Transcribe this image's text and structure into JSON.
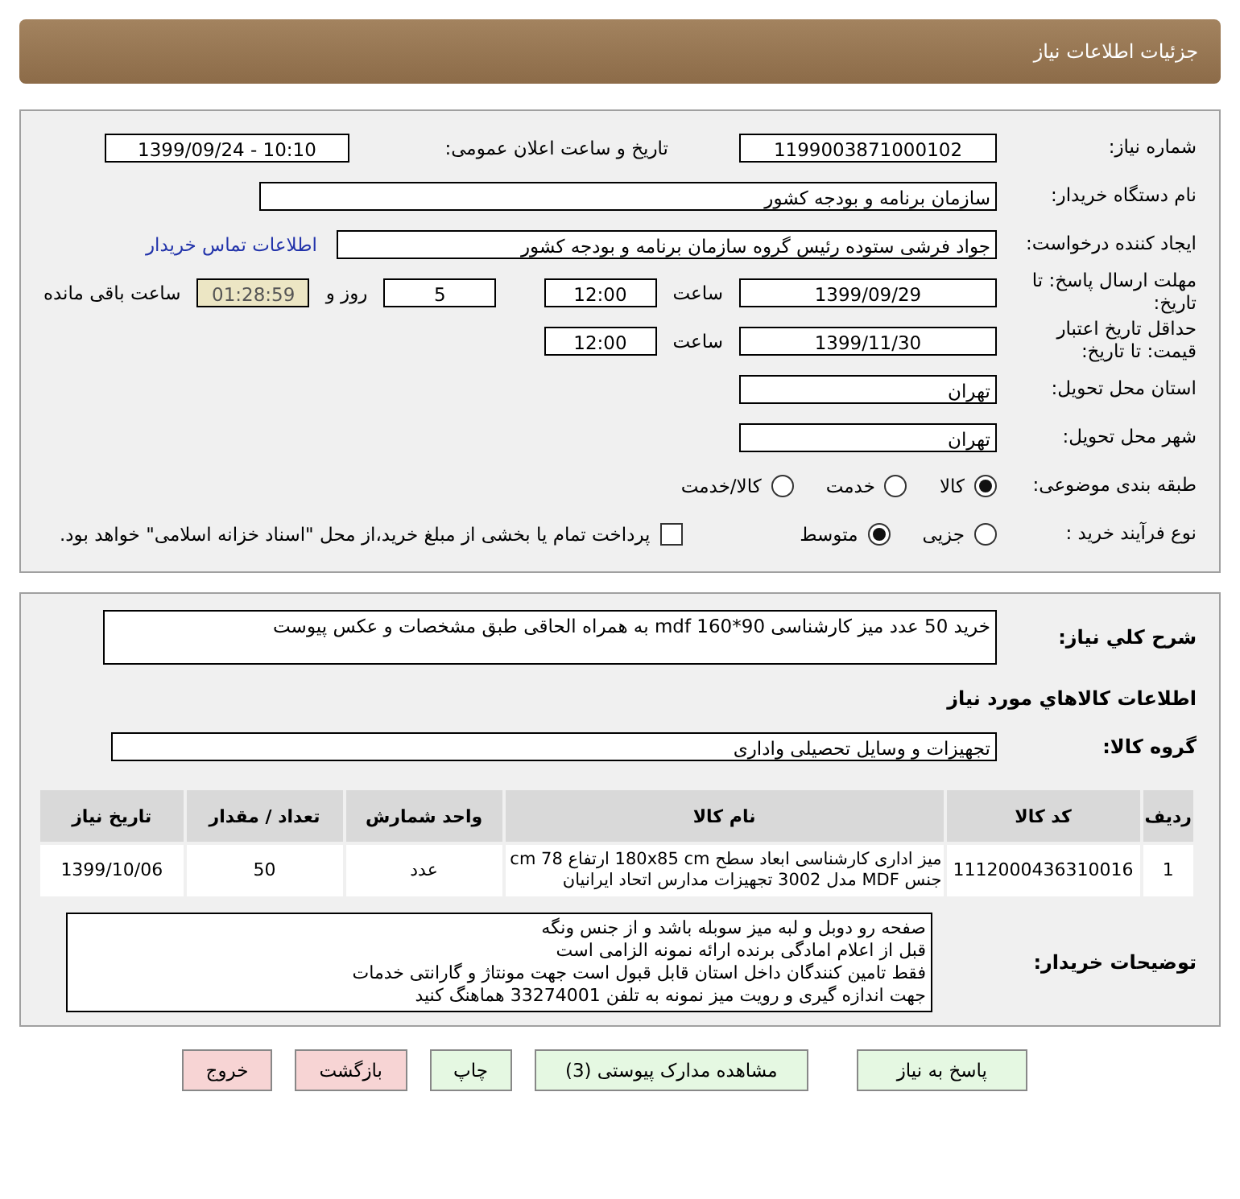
{
  "header": {
    "title": "جزئیات اطلاعات نیاز"
  },
  "need_number": {
    "label": "شماره نیاز:",
    "value": "1199003871000102"
  },
  "announce": {
    "label": "تاریخ و ساعت اعلان عمومی:",
    "value": "1399/09/24 - 10:10"
  },
  "buyer_org": {
    "label": "نام دستگاه خریدار:",
    "value": "سازمان برنامه و بودجه کشور"
  },
  "creator": {
    "label": "ایجاد کننده درخواست:",
    "value": "جواد فرشی ستوده رئیس گروه سازمان برنامه و بودجه کشور",
    "link": "اطلاعات تماس خریدار"
  },
  "deadline": {
    "label": "مهلت ارسال پاسخ: تا تاریخ:",
    "date": "1399/09/29",
    "time_label": "ساعت",
    "time": "12:00",
    "days": "5",
    "days_label": "روز و",
    "remaining": "01:28:59",
    "remaining_label": "ساعت باقی مانده"
  },
  "validity": {
    "label": "حداقل تاریخ اعتبار قیمت: تا تاریخ:",
    "date": "1399/11/30",
    "time_label": "ساعت",
    "time": "12:00"
  },
  "province": {
    "label": "استان محل تحویل:",
    "value": "تهران"
  },
  "city": {
    "label": "شهر محل تحویل:",
    "value": "تهران"
  },
  "category": {
    "label": "طبقه بندی موضوعی:",
    "options": [
      {
        "label": "کالا",
        "selected": true
      },
      {
        "label": "خدمت",
        "selected": false
      },
      {
        "label": "کالا/خدمت",
        "selected": false
      }
    ]
  },
  "process": {
    "label": "نوع فرآیند خرید :",
    "options": [
      {
        "label": "جزیی",
        "selected": false
      },
      {
        "label": "متوسط",
        "selected": true
      }
    ],
    "payment": {
      "checked": false,
      "text": "پرداخت تمام یا بخشی از مبلغ خرید،از محل \"اسناد خزانه اسلامی\" خواهد بود."
    }
  },
  "summary": {
    "label": "شرح کلي نياز:",
    "value": "خرید 50 عدد میز کارشناسی  90*160 mdf به همراه الحاقی طبق مشخصات و عکس پیوست"
  },
  "goods_heading": "اطلاعات کالاهاي مورد نياز",
  "goods_group": {
    "label": "گروه کالا:",
    "value": "تجهیزات و وسایل تحصیلی واداری"
  },
  "table": {
    "columns": [
      "ردیف",
      "کد کالا",
      "نام کالا",
      "واحد شمارش",
      "تعداد / مقدار",
      "تاریخ نیاز"
    ],
    "rows": [
      [
        "1",
        "1112000436310016",
        "میز اداری کارشناسی ابعاد سطح 180x85 cm ارتفاع 78 cm جنس MDF مدل 3002 تجهیزات مدارس اتحاد ایرانیان",
        "عدد",
        "50",
        "1399/10/06"
      ]
    ]
  },
  "buyer_notes": {
    "label": "توضیحات خریدار:",
    "lines": [
      "صفحه رو دوبل و لبه میز سوبله باشد و از جنس ونگه",
      "قبل از اعلام امادگی برنده ارائه نمونه الزامی است",
      "فقط تامین کنندگان داخل استان قابل قبول است جهت مونتاژ و گارانتی خدمات",
      "جهت اندازه گیری و رویت میز نمونه به تلفن 33274001 هماهنگ کنید"
    ]
  },
  "buttons": [
    {
      "label": "پاسخ به نیاز",
      "kind": "action"
    },
    {
      "label": "مشاهده مدارک پیوستی (3)",
      "kind": "action"
    },
    {
      "label": "چاپ",
      "kind": "action"
    },
    {
      "label": "بازگشت",
      "kind": "nav"
    },
    {
      "label": "خروج",
      "kind": "nav"
    }
  ]
}
